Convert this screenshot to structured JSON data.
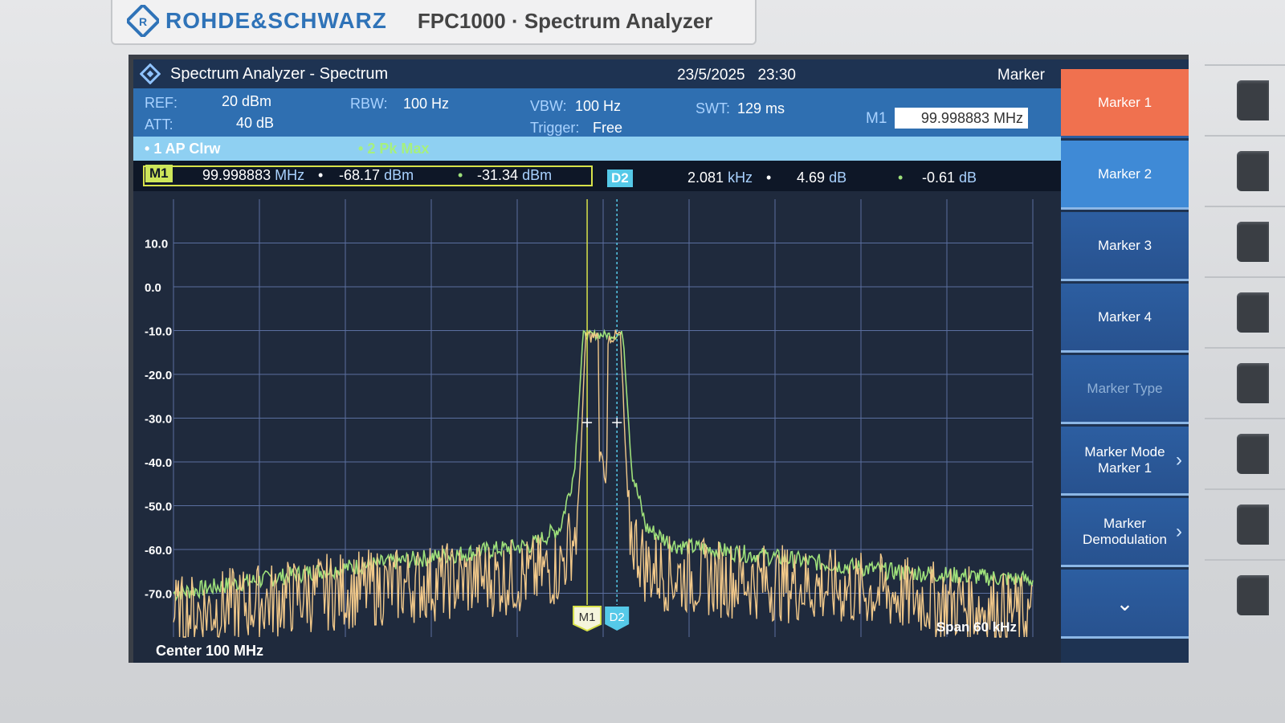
{
  "brand": {
    "name": "ROHDE&SCHWARZ",
    "model": "FPC1000 · Spectrum Analyzer"
  },
  "titlebar": {
    "title": "Spectrum Analyzer - Spectrum",
    "date": "23/5/2025",
    "time": "23:30",
    "softkey_title": "Marker"
  },
  "params": {
    "ref_label": "REF:",
    "ref_value": "20 dBm",
    "att_label": "ATT:",
    "att_value": "40 dB",
    "rbw_label": "RBW:",
    "rbw_value": "100 Hz",
    "vbw_label": "VBW:",
    "vbw_value": "100 Hz",
    "trigger_label": "Trigger:",
    "trigger_value": "Free",
    "swt_label": "SWT:",
    "swt_value": "129 ms",
    "m1_entry_label": "M1",
    "m1_entry_value": "99.998883 MHz"
  },
  "traces": {
    "trace1": "1 AP Clrw",
    "trace2": "2 Pk Max"
  },
  "markers": {
    "m1": {
      "tag": "M1",
      "freq": "99.998883",
      "freq_unit": "MHz",
      "level": "-68.17",
      "level_unit": "dBm",
      "level2": "-31.34",
      "level2_unit": "dBm"
    },
    "d2": {
      "tag": "D2",
      "freq": "2.081",
      "freq_unit": "kHz",
      "delta": "4.69",
      "delta_unit": "dB",
      "delta2": "-0.61",
      "delta2_unit": "dB"
    }
  },
  "plot": {
    "center_label": "Center 100 MHz",
    "span_label": "Span 60 kHz",
    "marker_m1_label": "M1",
    "marker_d2_label": "D2"
  },
  "softkeys": [
    {
      "label": "Marker 1",
      "state": "active"
    },
    {
      "label": "Marker 2",
      "state": "selected"
    },
    {
      "label": "Marker 3",
      "state": "normal"
    },
    {
      "label": "Marker 4",
      "state": "normal"
    },
    {
      "label": "Marker Type",
      "state": "disabled"
    },
    {
      "label": "Marker Mode",
      "label2": "Marker 1",
      "state": "submenu"
    },
    {
      "label": "Marker",
      "label2": "Demodulation",
      "state": "submenu"
    },
    {
      "label": "⌄",
      "state": "more"
    }
  ],
  "colors": {
    "trace1": "#f2c98a",
    "trace2": "#9ee07a",
    "grid": "#5b6fa0",
    "active_softkey": "#f0714f",
    "param_bar": "#2f6fb1",
    "marker_m1": "#d8e24a",
    "marker_d2": "#55c9e8"
  },
  "chart_data": {
    "type": "line",
    "xlabel": "",
    "ylabel": "",
    "x_range_khz": [
      -30,
      30
    ],
    "ylim": [
      -80,
      20
    ],
    "y_ticks": [
      "10.0",
      "0.0",
      "-10.0",
      "-20.0",
      "-30.0",
      "-40.0",
      "-50.0",
      "-60.0",
      "-70.0"
    ],
    "y_tick_values": [
      10,
      0,
      -10,
      -20,
      -30,
      -40,
      -50,
      -60,
      -70
    ],
    "grid": true,
    "series": [
      {
        "name": "1 AP Clrw",
        "x": [
          -30,
          -20,
          -10,
          -5,
          -3,
          -1.8,
          -1.2,
          0,
          1.2,
          1.8,
          3,
          5,
          10,
          20,
          30
        ],
        "values": [
          -75,
          -70,
          -67,
          -66,
          -64,
          -55,
          -11,
          -12,
          -11,
          -55,
          -64,
          -66,
          -67,
          -70,
          -75
        ]
      },
      {
        "name": "2 Pk Max",
        "x": [
          -30,
          -20,
          -10,
          -5,
          -3,
          -2,
          -1.4,
          0,
          1.4,
          2,
          3,
          5,
          10,
          20,
          30
        ],
        "values": [
          -70,
          -65,
          -61,
          -59,
          -55,
          -42,
          -11,
          -11,
          -11,
          -42,
          -55,
          -59,
          -61,
          -65,
          -67
        ]
      }
    ],
    "markers": [
      {
        "name": "M1",
        "x_khz": -1.117,
        "level_dbm": -68.17
      },
      {
        "name": "D2",
        "x_khz": 0.964,
        "delta_db": 4.69
      }
    ]
  }
}
